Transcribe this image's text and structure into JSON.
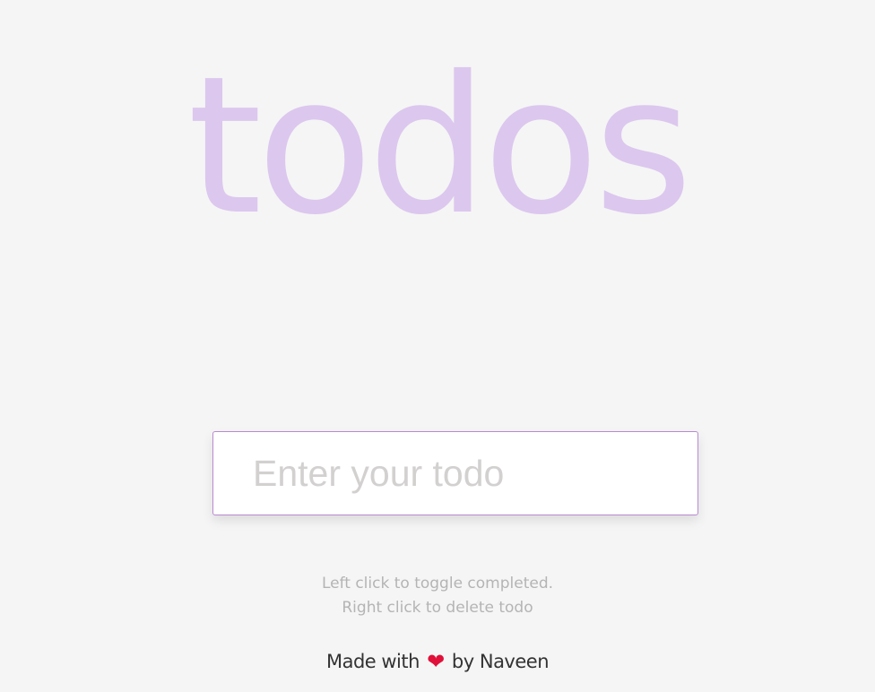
{
  "header": {
    "title": "todos"
  },
  "todo_form": {
    "input_value": "",
    "input_placeholder": "Enter your todo"
  },
  "hints": {
    "toggle": "Left click to toggle completed.",
    "delete": "Right click to delete todo"
  },
  "footer": {
    "made_with": "Made with",
    "heart_symbol": "❤",
    "by_author": "by Naveen"
  },
  "colors": {
    "background": "#f5f5f5",
    "title": "#dcc7ee",
    "input_border": "#b98ad1",
    "heart": "#e0103a"
  },
  "icons": {
    "heart": "heart-icon"
  }
}
